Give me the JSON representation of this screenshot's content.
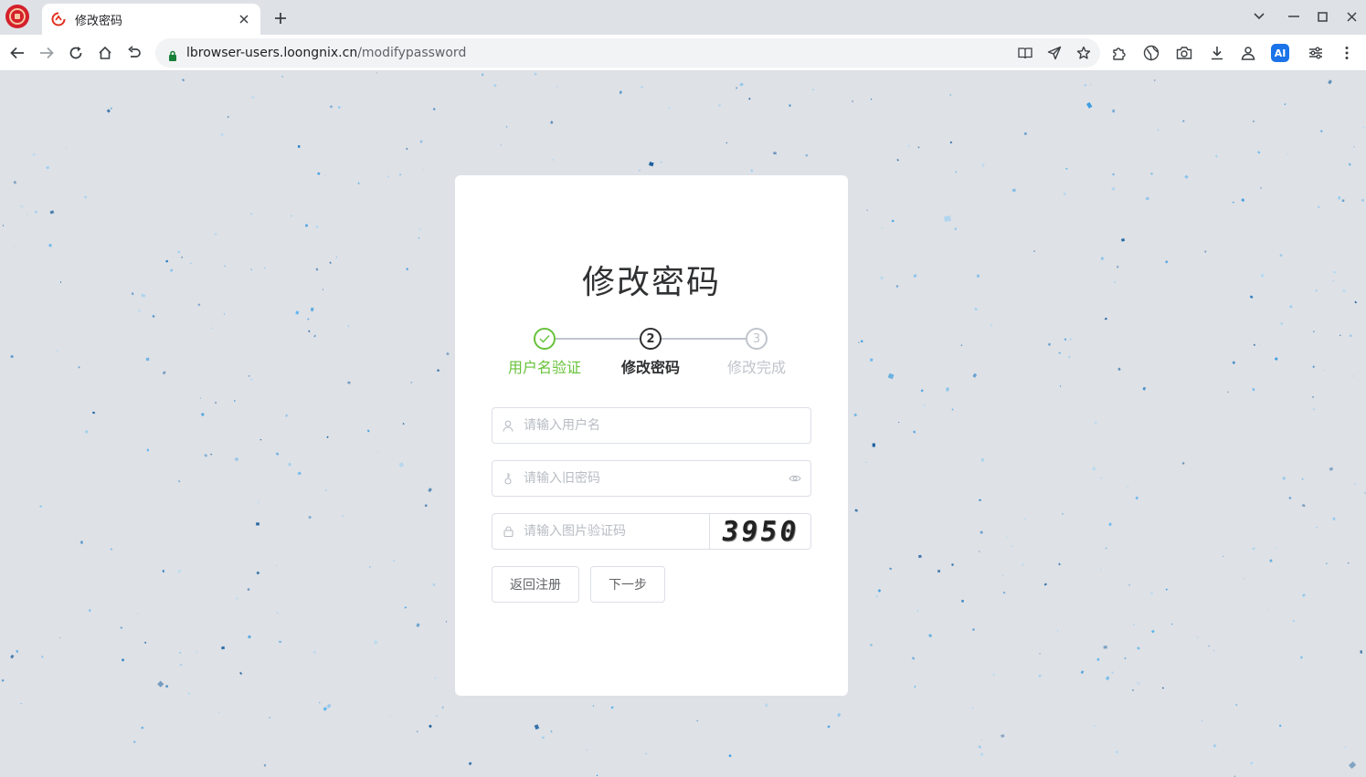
{
  "browser": {
    "tab": {
      "title": "修改密码"
    },
    "url": {
      "host": "lbrowser-users.loongnix.cn",
      "path": "/modifypassword"
    }
  },
  "page": {
    "title": "修改密码",
    "steps": [
      {
        "index": "✓",
        "label": "用户名验证",
        "status": "done"
      },
      {
        "index": "2",
        "label": "修改密码",
        "status": "active"
      },
      {
        "index": "3",
        "label": "修改完成",
        "status": "wait"
      }
    ],
    "form": {
      "username_placeholder": "请输入用户名",
      "old_password_placeholder": "请输入旧密码",
      "captcha_placeholder": "请输入图片验证码",
      "captcha_code": "3950"
    },
    "buttons": {
      "back": "返回注册",
      "next": "下一步"
    }
  },
  "colors": {
    "success": "#67c23a",
    "active": "#303133",
    "wait": "#c0c4cc",
    "background": "#dee1e6",
    "particle": "#4aa3df"
  }
}
